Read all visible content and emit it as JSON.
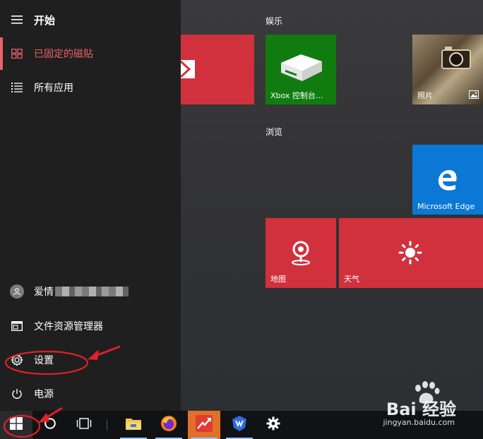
{
  "start_menu": {
    "header_label": "开始",
    "items": [
      {
        "label": "已固定的磁贴",
        "icon": "pinned-tiles-icon",
        "selected": true
      },
      {
        "label": "所有应用",
        "icon": "all-apps-list-icon"
      }
    ],
    "bottom": {
      "user_label": "爱情",
      "explorer_label": "文件资源管理器",
      "settings_label": "设置",
      "power_label": "电源"
    },
    "accent_color": "#e8626a"
  },
  "tiles": {
    "groups": {
      "entertainment_label": "娱乐",
      "browse_label": "浏览"
    },
    "items": [
      {
        "name": "mail",
        "label": "",
        "color": "#d0313c"
      },
      {
        "name": "xbox",
        "label": "Xbox 控制台...",
        "color": "#107c10"
      },
      {
        "name": "photos",
        "label": "照片",
        "color": "#7a6a50"
      },
      {
        "name": "edge",
        "label": "Microsoft Edge",
        "color": "#0a78d4"
      },
      {
        "name": "maps",
        "label": "地图",
        "color": "#d0313c"
      },
      {
        "name": "weather",
        "label": "天气",
        "color": "#d0313c"
      }
    ]
  },
  "taskbar": {
    "apps": [
      "start-button",
      "search-button",
      "task-view-button",
      "file-explorer",
      "firefox",
      "red-arrow-app",
      "shield-app",
      "settings-app"
    ]
  },
  "watermark": {
    "brand": "Bai 经验",
    "url": "jingyan.baidu.com"
  },
  "annotation_color": "#e0202a"
}
